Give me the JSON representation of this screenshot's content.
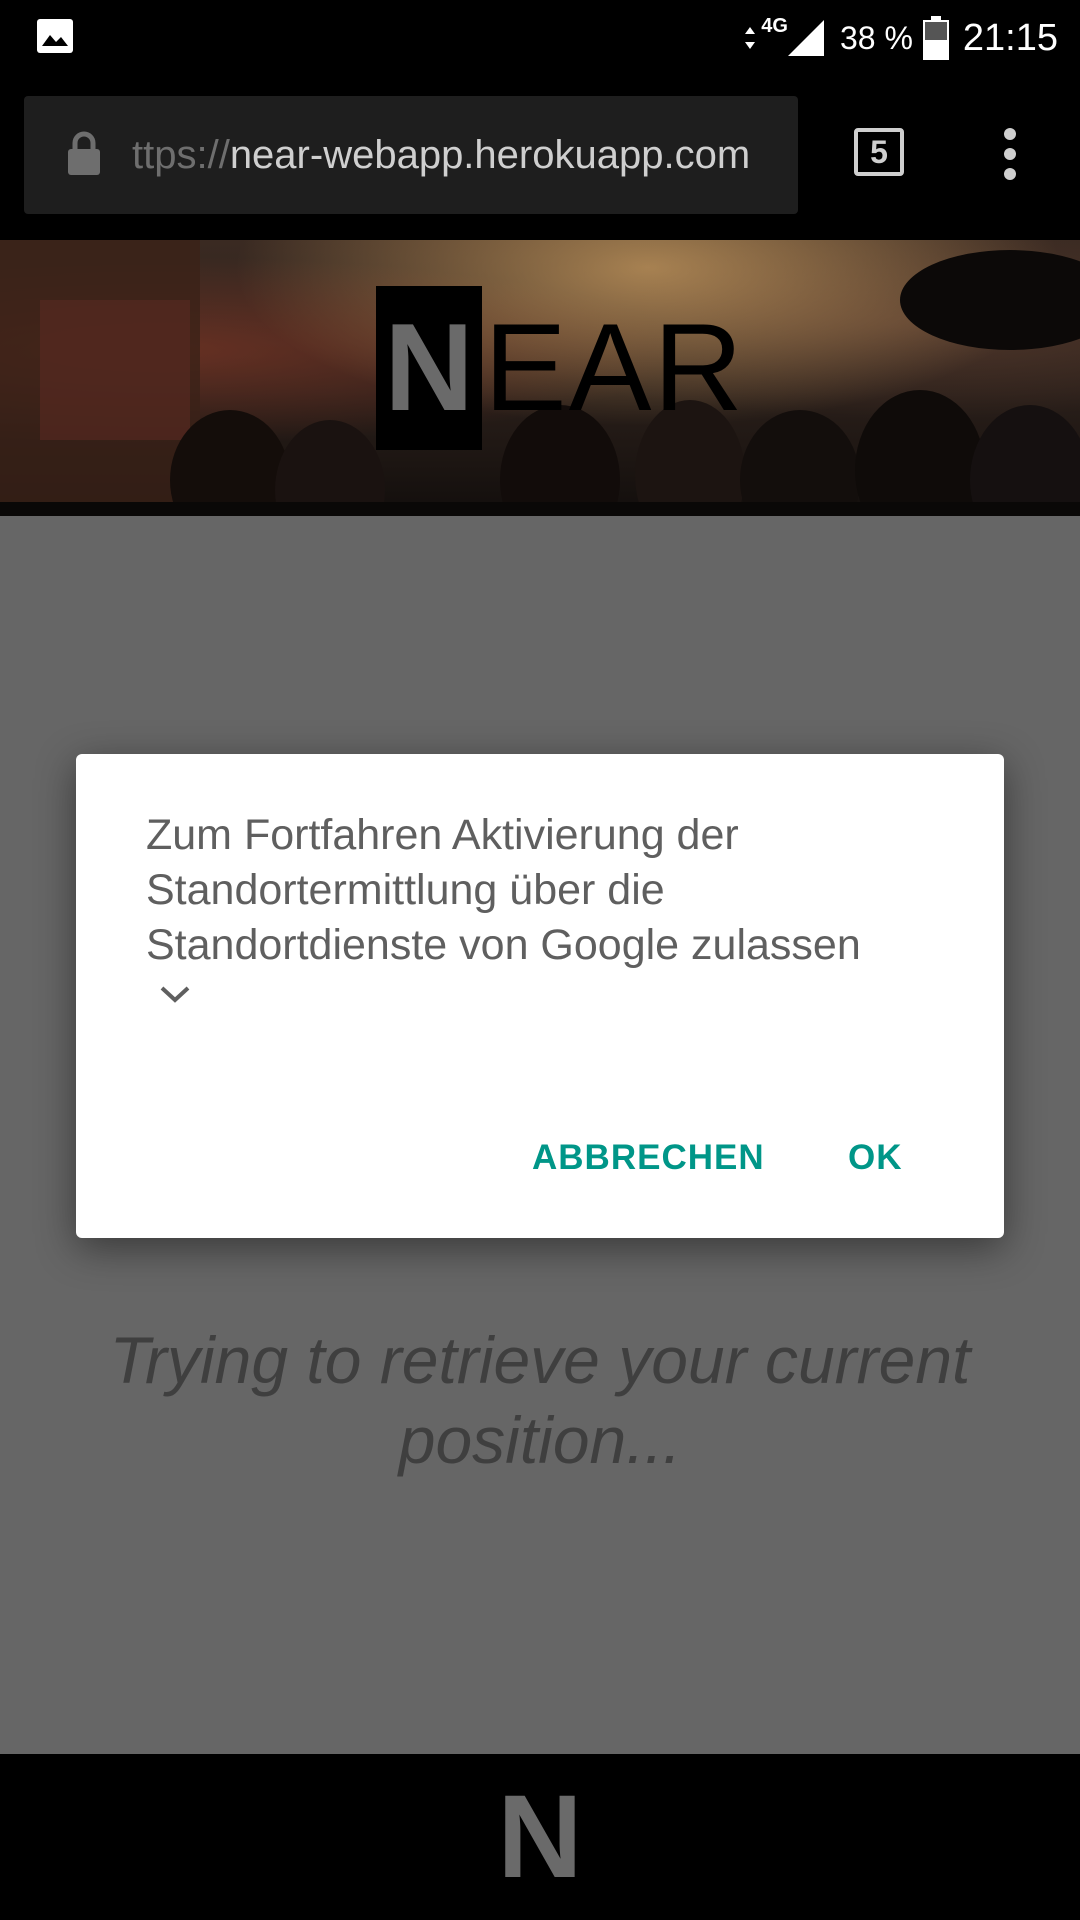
{
  "status_bar": {
    "network": "4G",
    "battery": "38 %",
    "time": "21:15",
    "icons": [
      "image-icon",
      "data-arrows-icon",
      "signal-icon",
      "battery-icon"
    ]
  },
  "browser": {
    "url_scheme": "ttps://",
    "url_host": "near-webapp.herokuapp.com",
    "tab_count": "5",
    "icons": [
      "lock-icon",
      "more-vert-icon"
    ]
  },
  "header": {
    "logo_first": "N",
    "logo_rest": "EAR"
  },
  "page": {
    "status_message": "Trying to retrieve your current position..."
  },
  "dialog": {
    "message": "Zum Fortfahren Aktivierung der Standortermittlung über die Standortdienste von Google zulassen",
    "cancel_label": "ABBRECHEN",
    "ok_label": "OK",
    "accent_color": "#009688"
  },
  "footer": {
    "logo": "N"
  }
}
